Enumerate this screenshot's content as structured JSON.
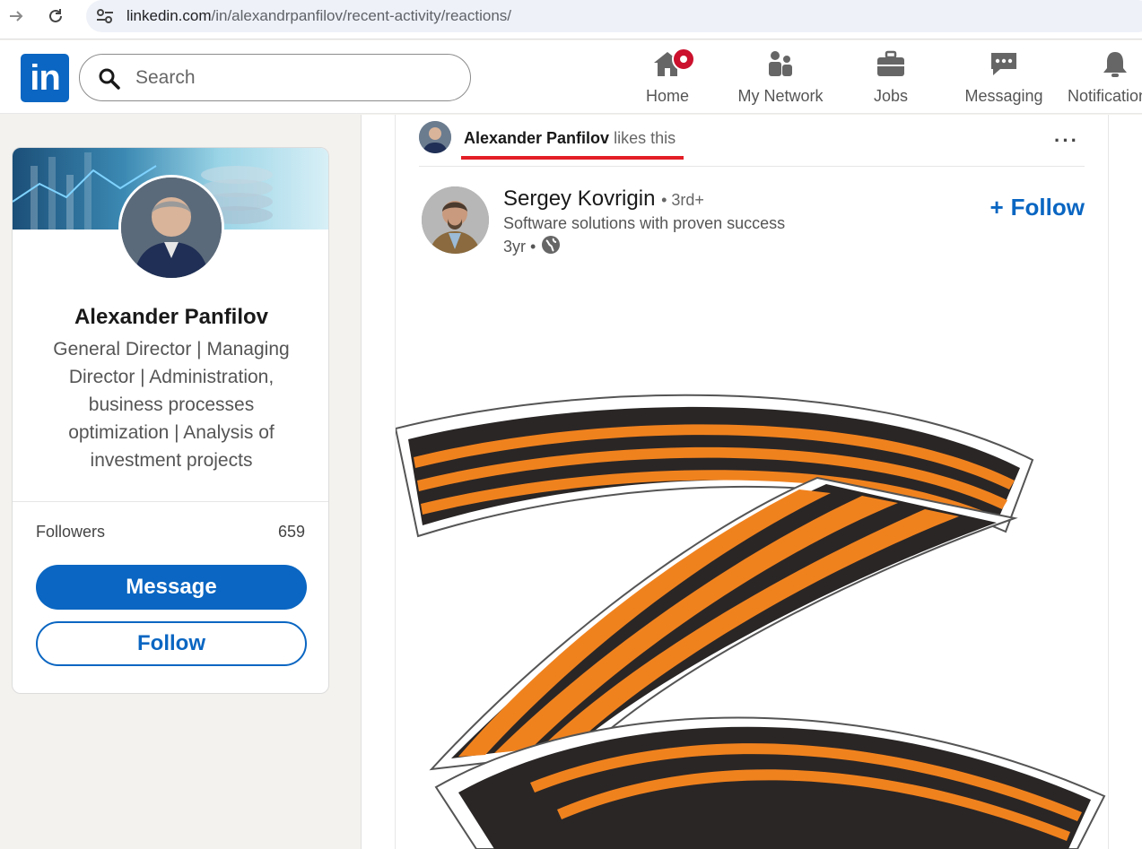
{
  "browser": {
    "url_host": "linkedin.com",
    "url_path": "/in/alexandrpanfilov/recent-activity/reactions/"
  },
  "header": {
    "logo": "in",
    "search_placeholder": "Search",
    "nav": [
      {
        "label": "Home",
        "icon": "home-icon"
      },
      {
        "label": "My Network",
        "icon": "network-icon"
      },
      {
        "label": "Jobs",
        "icon": "briefcase-icon"
      },
      {
        "label": "Messaging",
        "icon": "chat-icon"
      },
      {
        "label": "Notifications",
        "icon": "bell-icon"
      }
    ]
  },
  "profile": {
    "name": "Alexander Panfilov",
    "headline": "General Director | Managing Director | Administration, business processes optimization | Analysis of investment projects",
    "followers_label": "Followers",
    "followers_count": "659",
    "message_label": "Message",
    "follow_label": "Follow"
  },
  "post": {
    "actor": "Alexander Panfilov",
    "verb": "likes this",
    "more": "···",
    "author_name": "Sergey Kovrigin",
    "author_degree": "• 3rd+",
    "author_headline": "Software solutions with proven success",
    "time": "3yr •",
    "follow_label": "Follow",
    "follow_plus": "+"
  },
  "colors": {
    "brand": "#0a66c2",
    "notification": "#cb112d",
    "highlight": "#e31e26",
    "stripe_orange": "#f0821e",
    "stripe_black": "#2a2626"
  }
}
